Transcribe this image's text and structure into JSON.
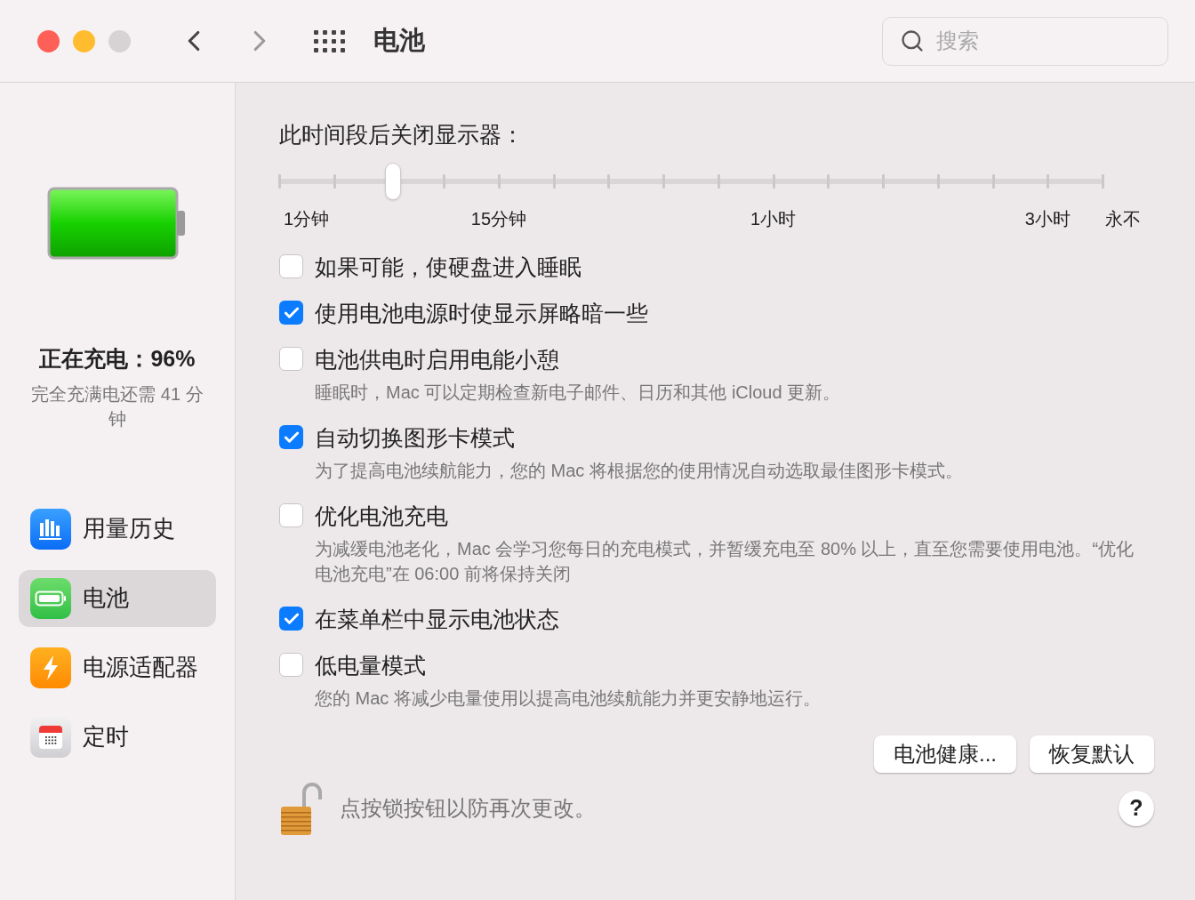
{
  "window": {
    "title": "电池",
    "search": {
      "placeholder": "搜索"
    }
  },
  "sidebar": {
    "status": "正在充电：96%",
    "remaining": "完全充满电还需 41 分钟",
    "items": [
      {
        "label": "用量历史",
        "kind": "history",
        "selected": false
      },
      {
        "label": "电池",
        "kind": "battery",
        "selected": true
      },
      {
        "label": "电源适配器",
        "kind": "adapter",
        "selected": false
      },
      {
        "label": "定时",
        "kind": "schedule",
        "selected": false
      }
    ]
  },
  "display_off": {
    "label": "此时间段后关闭显示器：",
    "level": 0.138,
    "tick_labels": [
      "1分钟",
      "15分钟",
      "1小时",
      "3小时",
      "永不"
    ]
  },
  "options": [
    {
      "label": "如果可能，使硬盘进入睡眠",
      "checked": false
    },
    {
      "label": "使用电池电源时使显示屏略暗一些",
      "checked": true
    },
    {
      "label": "电池供电时启用电能小憩",
      "checked": false,
      "description": "睡眠时，Mac 可以定期检查新电子邮件、日历和其他 iCloud 更新。"
    },
    {
      "label": "自动切换图形卡模式",
      "checked": true,
      "description": "为了提高电池续航能力，您的 Mac 将根据您的使用情况自动选取最佳图形卡模式。"
    },
    {
      "label": "优化电池充电",
      "checked": false,
      "description": "为减缓电池老化，Mac 会学习您每日的充电模式，并暂缓充电至 80% 以上，直至您需要使用电池。“优化电池充电”在 06:00 前将保持关闭"
    },
    {
      "label": "在菜单栏中显示电池状态",
      "checked": true
    },
    {
      "label": "低电量模式",
      "checked": false,
      "description": "您的 Mac 将减少电量使用以提高电池续航能力并更安静地运行。"
    }
  ],
  "buttons": [
    "电池健康...",
    "恢复默认"
  ],
  "lock_text": "点按锁按钮以防再次更改。",
  "help": "?"
}
